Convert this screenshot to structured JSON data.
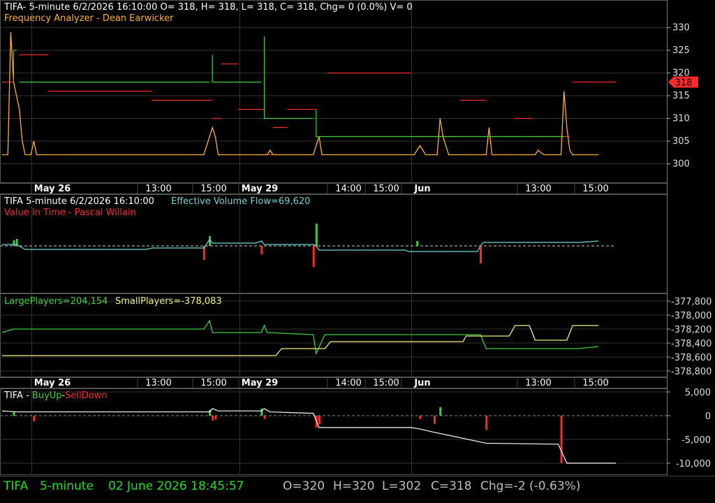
{
  "colors": {
    "background": "#000000",
    "grid": "#333333",
    "axis_text": "#dddddd",
    "header_white": "#ffffff",
    "orange": "#ffb030",
    "red": "#ff2a2a",
    "green": "#3fd03f",
    "cyan": "#6fd6d6",
    "yellow": "#f2f27a",
    "status_green": "#1fe01f",
    "status_gray": "#bdbdbd"
  },
  "panels": {
    "main": {
      "header": "TIFA- 5-minute 6/2/2026 16:10:00 O= 318, H= 318, L= 318, C= 318, Chg= 0 (0.0%) V= 0",
      "indicator": "Frequency Analyzer - Dean Earwicker",
      "current_price_tag": "318"
    },
    "evf": {
      "header_left": "TIFA 5-minute  6/2/2026 16:10:00",
      "header_right": "Effective Volume Flow=69,620",
      "indicator": "Value In Time - Pascal Willain"
    },
    "players": {
      "large_label": "LargePlayers=204,154",
      "small_label": "SmallPlayers=-378,083"
    },
    "buyup": {
      "prefix": "TIFA - ",
      "buy": "BuyUp",
      "dash": "-",
      "sell": "SellDown"
    }
  },
  "status_bar": {
    "symbol": "TIFA",
    "interval": "5-minute",
    "datetime": "02 June 2026 18:45:57",
    "open": "O=320",
    "high": "H=320",
    "low": "L=302",
    "close": "C=318",
    "change": "Chg=-2 (-0.63%)"
  },
  "chart_data": [
    {
      "type": "line",
      "panel": "main",
      "x_ticks": [
        "May 26",
        "13:00",
        "15:00",
        "May 29",
        "14:00",
        "15:00",
        "Jun",
        "13:00",
        "15:00"
      ],
      "y_ticks": [
        300,
        305,
        310,
        315,
        320,
        325,
        330
      ],
      "ylim": [
        297,
        333
      ],
      "n_bars": 200,
      "series": [
        {
          "name": "TIFA",
          "color": "orange",
          "points": [
            [
              0,
              302
            ],
            [
              2,
              302
            ],
            [
              3,
              329
            ],
            [
              4,
              318
            ],
            [
              5,
              315
            ],
            [
              6,
              312
            ],
            [
              7,
              305
            ],
            [
              8,
              302
            ],
            [
              10,
              302
            ],
            [
              11,
              305
            ],
            [
              12,
              302
            ],
            [
              20,
              302
            ],
            [
              60,
              302
            ],
            [
              70,
              302
            ],
            [
              72,
              306
            ],
            [
              73,
              308
            ],
            [
              74,
              306
            ],
            [
              75,
              302
            ],
            [
              90,
              302
            ],
            [
              92,
              302
            ],
            [
              93,
              303
            ],
            [
              94,
              302
            ],
            [
              100,
              302
            ],
            [
              108,
              302
            ],
            [
              110,
              306
            ],
            [
              111,
              302
            ],
            [
              135,
              302
            ],
            [
              143,
              302
            ],
            [
              145,
              304
            ],
            [
              147,
              302
            ],
            [
              151,
              302
            ],
            [
              152,
              310
            ],
            [
              153,
              306
            ],
            [
              155,
              302
            ],
            [
              166,
              302
            ],
            [
              168,
              302
            ],
            [
              169,
              308
            ],
            [
              170,
              302
            ],
            [
              181,
              302
            ],
            [
              185,
              302
            ],
            [
              186,
              303
            ],
            [
              188,
              302
            ],
            [
              190,
              302
            ],
            [
              194,
              302
            ],
            [
              195,
              316
            ],
            [
              196,
              308
            ],
            [
              197,
              303
            ],
            [
              198,
              302
            ],
            [
              207,
              302
            ]
          ]
        },
        {
          "name": "TIFA green",
          "color": "green",
          "points": [
            [
              4,
              318
            ],
            [
              5,
              325
            ],
            [
              6,
              318
            ],
            [
              72,
              318
            ],
            [
              73,
              324
            ],
            [
              90,
              318
            ],
            [
              91,
              328
            ],
            [
              108,
              310
            ],
            [
              109,
              312
            ],
            [
              195,
              306
            ],
            [
              196,
              309
            ]
          ]
        }
      ],
      "levels": [
        {
          "y": 318,
          "x0": 0,
          "x1": 4
        },
        {
          "y": 324,
          "x0": 6,
          "x1": 16
        },
        {
          "y": 316,
          "x0": 16,
          "x1": 52
        },
        {
          "y": 314,
          "x0": 52,
          "x1": 73
        },
        {
          "y": 310,
          "x0": 73,
          "x1": 76
        },
        {
          "y": 322,
          "x0": 76,
          "x1": 82
        },
        {
          "y": 312,
          "x0": 82,
          "x1": 91
        },
        {
          "y": 302,
          "x0": 91,
          "x1": 96
        },
        {
          "y": 308,
          "x0": 94,
          "x1": 99
        },
        {
          "y": 312,
          "x0": 99,
          "x1": 109
        },
        {
          "y": 320,
          "x0": 113,
          "x1": 142
        },
        {
          "y": 306,
          "x0": 143,
          "x1": 158
        },
        {
          "y": 314,
          "x0": 159,
          "x1": 168
        },
        {
          "y": 310,
          "x0": 178,
          "x1": 184
        },
        {
          "y": 306,
          "x0": 184,
          "x1": 197
        },
        {
          "y": 318,
          "x0": 198,
          "x1": 213
        }
      ]
    },
    {
      "type": "line",
      "panel": "evf",
      "name": "Effective Volume Flow",
      "color": "cyan",
      "points": [
        [
          0,
          350
        ],
        [
          5,
          350
        ],
        [
          8,
          357
        ],
        [
          50,
          357
        ],
        [
          52,
          355
        ],
        [
          70,
          355
        ],
        [
          72,
          343
        ],
        [
          73,
          348
        ],
        [
          88,
          348
        ],
        [
          90,
          345
        ],
        [
          91,
          350
        ],
        [
          108,
          350
        ],
        [
          109,
          352
        ],
        [
          110,
          358
        ],
        [
          140,
          358
        ],
        [
          141,
          360
        ],
        [
          165,
          360
        ],
        [
          166,
          352
        ],
        [
          167,
          347
        ],
        [
          200,
          347
        ],
        [
          207,
          345
        ]
      ],
      "histogram_bars": [
        [
          4,
          8
        ],
        [
          5,
          10
        ],
        [
          70,
          -20
        ],
        [
          72,
          14
        ],
        [
          90,
          -12
        ],
        [
          108,
          -30
        ],
        [
          109,
          32
        ],
        [
          144,
          7
        ],
        [
          166,
          -25
        ]
      ]
    },
    {
      "type": "line",
      "panel": "players",
      "y_ticks": [
        "-377,800",
        "-378,000",
        "-378,200",
        "-378,400",
        "-378,600",
        "-378,800"
      ],
      "series": [
        {
          "name": "LargePlayers",
          "color": "green",
          "points": [
            [
              0,
              378250
            ],
            [
              4,
              378200
            ],
            [
              70,
              378200
            ],
            [
              72,
              378080
            ],
            [
              73,
              378250
            ],
            [
              90,
              378250
            ],
            [
              91,
              378150
            ],
            [
              92,
              378250
            ],
            [
              108,
              378280
            ],
            [
              109,
              378550
            ],
            [
              112,
              378280
            ],
            [
              166,
              378280
            ],
            [
              168,
              378480
            ],
            [
              200,
              378480
            ],
            [
              207,
              378450
            ]
          ]
        },
        {
          "name": "SmallPlayers",
          "color": "yellow",
          "points": [
            [
              0,
              378580
            ],
            [
              95,
              378580
            ],
            [
              97,
              378480
            ],
            [
              112,
              378480
            ],
            [
              114,
              378380
            ],
            [
              160,
              378380
            ],
            [
              161,
              378300
            ],
            [
              176,
              378300
            ],
            [
              178,
              378150
            ],
            [
              183,
              378150
            ],
            [
              185,
              378360
            ],
            [
              196,
              378360
            ],
            [
              198,
              378150
            ],
            [
              207,
              378150
            ]
          ]
        }
      ]
    },
    {
      "type": "line",
      "panel": "buyup",
      "y_ticks": [
        "5,000",
        "0",
        "-5,000",
        "-10,000"
      ],
      "series": [
        {
          "name": "cumulative",
          "color": "white",
          "points": [
            [
              0,
              1000
            ],
            [
              5,
              800
            ],
            [
              12,
              800
            ],
            [
              72,
              800
            ],
            [
              73,
              1500
            ],
            [
              75,
              1000
            ],
            [
              90,
              1000
            ],
            [
              91,
              1500
            ],
            [
              93,
              800
            ],
            [
              108,
              500
            ],
            [
              110,
              -2500
            ],
            [
              142,
              -2500
            ],
            [
              145,
              -2800
            ],
            [
              150,
              -3500
            ],
            [
              168,
              -5800
            ],
            [
              193,
              -6000
            ],
            [
              196,
              -10000
            ],
            [
              213,
              -10000
            ]
          ]
        }
      ],
      "histogram_bars": [
        [
          4,
          900
        ],
        [
          11,
          -1200
        ],
        [
          72,
          1200
        ],
        [
          73,
          -1000
        ],
        [
          74,
          -800
        ],
        [
          90,
          1500
        ],
        [
          91,
          -700
        ],
        [
          109,
          -2500
        ],
        [
          110,
          -1800
        ],
        [
          145,
          -700
        ],
        [
          150,
          -1700
        ],
        [
          152,
          1800
        ],
        [
          168,
          -3000
        ],
        [
          194,
          -10000
        ]
      ]
    }
  ]
}
